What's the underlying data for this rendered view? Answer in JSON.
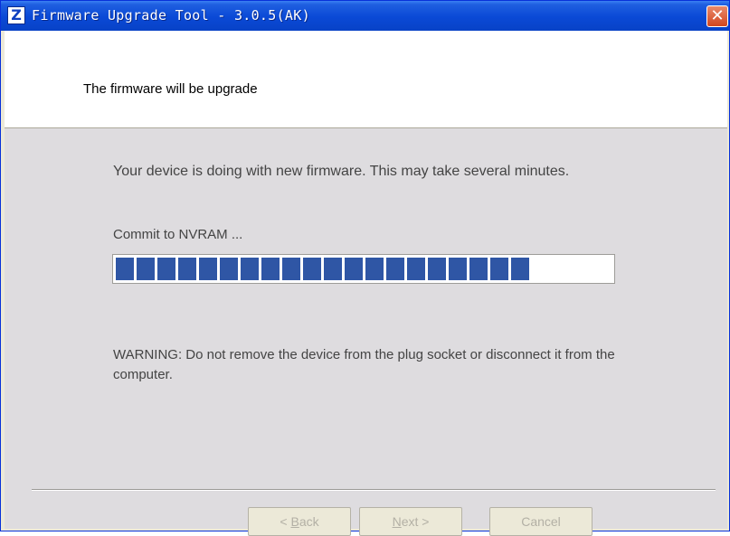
{
  "window": {
    "title": "Firmware Upgrade Tool - 3.0.5(AK)",
    "icon": "Z",
    "close_glyph": "✕",
    "title_color": "#0a49d6"
  },
  "header": {
    "text": "The firmware will be upgrade"
  },
  "main": {
    "message": "Your device is doing with new firmware. This may take several minutes.",
    "status": "Commit to NVRAM ...",
    "progress": {
      "filled_segments": 20,
      "total_segments": 24,
      "color": "#2f56a5"
    },
    "warning": "WARNING: Do not remove the device from the plug socket or disconnect it from the computer."
  },
  "buttons": {
    "back": {
      "prefix": "< ",
      "mnemonic": "B",
      "rest": "ack",
      "enabled": false
    },
    "next": {
      "prefix": "",
      "mnemonic": "N",
      "rest": "ext >",
      "enabled": false
    },
    "cancel": {
      "label": "Cancel",
      "enabled": false
    }
  }
}
